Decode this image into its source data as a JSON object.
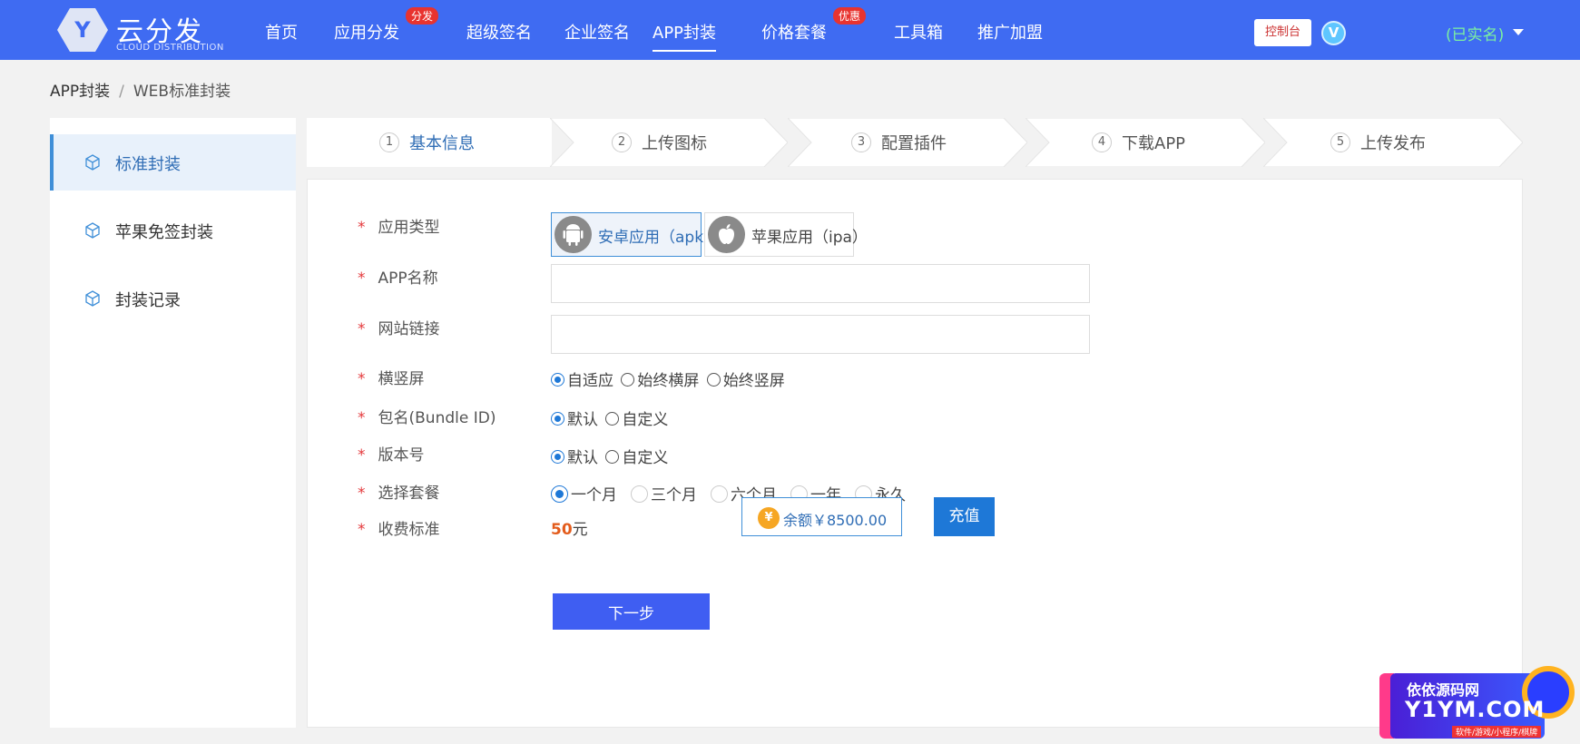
{
  "brand": {
    "name": "云分发",
    "sub": "CLOUD DISTRIBUTION",
    "logo_letter": "Y"
  },
  "nav": {
    "items": [
      {
        "label": "首页"
      },
      {
        "label": "应用分发",
        "badge": "分发"
      },
      {
        "label": "超级签名"
      },
      {
        "label": "企业签名"
      },
      {
        "label": "APP封装",
        "active": true
      },
      {
        "label": "价格套餐",
        "badge": "优惠"
      },
      {
        "label": "工具箱"
      },
      {
        "label": "推广加盟"
      }
    ],
    "console": "控制台",
    "vip_icon": "V",
    "user_status": "(已实名)"
  },
  "breadcrumb": {
    "parent": "APP封装",
    "sep": "/",
    "current": "WEB标准封装"
  },
  "sidebar": {
    "items": [
      {
        "label": "标准封装",
        "icon": "cube-icon",
        "active": true
      },
      {
        "label": "苹果免签封装",
        "icon": "cube-icon"
      },
      {
        "label": "封装记录",
        "icon": "cube-icon"
      }
    ]
  },
  "steps": [
    {
      "num": "1",
      "label": "基本信息",
      "active": true
    },
    {
      "num": "2",
      "label": "上传图标"
    },
    {
      "num": "3",
      "label": "配置插件"
    },
    {
      "num": "4",
      "label": "下载APP"
    },
    {
      "num": "5",
      "label": "上传发布"
    }
  ],
  "form": {
    "required_mark": "*",
    "app_type": {
      "label": "应用类型",
      "options": [
        {
          "label": "安卓应用（apk）",
          "icon": "android-icon",
          "selected": true
        },
        {
          "label": "苹果应用（ipa）",
          "icon": "apple-icon"
        }
      ]
    },
    "app_name": {
      "label": "APP名称",
      "value": "",
      "placeholder": ""
    },
    "site_url": {
      "label": "网站链接",
      "value": "",
      "placeholder": ""
    },
    "orientation": {
      "label": "横竖屏",
      "options": [
        "自适应",
        "始终横屏",
        "始终竖屏"
      ],
      "selected": "自适应"
    },
    "bundle_id": {
      "label": "包名(Bundle ID)",
      "options": [
        "默认",
        "自定义"
      ],
      "selected": "默认"
    },
    "version": {
      "label": "版本号",
      "options": [
        "默认",
        "自定义"
      ],
      "selected": "默认"
    },
    "plan": {
      "label": "选择套餐",
      "options": [
        "一个月",
        "三个月",
        "六个月",
        "一年",
        "永久"
      ],
      "selected": "一个月"
    },
    "fee": {
      "label": "收费标准",
      "amount": "50",
      "unit": "元"
    },
    "balance": {
      "text": "余额￥8500.00",
      "coin_icon": "¥"
    },
    "recharge": "充值",
    "next": "下一步"
  },
  "watermark": {
    "line1": "依依源码网",
    "line2": "Y1YM.COM",
    "line3": "软件/游戏/小程序/棋牌"
  },
  "colors": {
    "topbar": "#3f6bf2",
    "accent": "#1e78d7",
    "active_text": "#2f6db5",
    "required": "#e4393c",
    "fee_amount": "#e35c1c"
  }
}
